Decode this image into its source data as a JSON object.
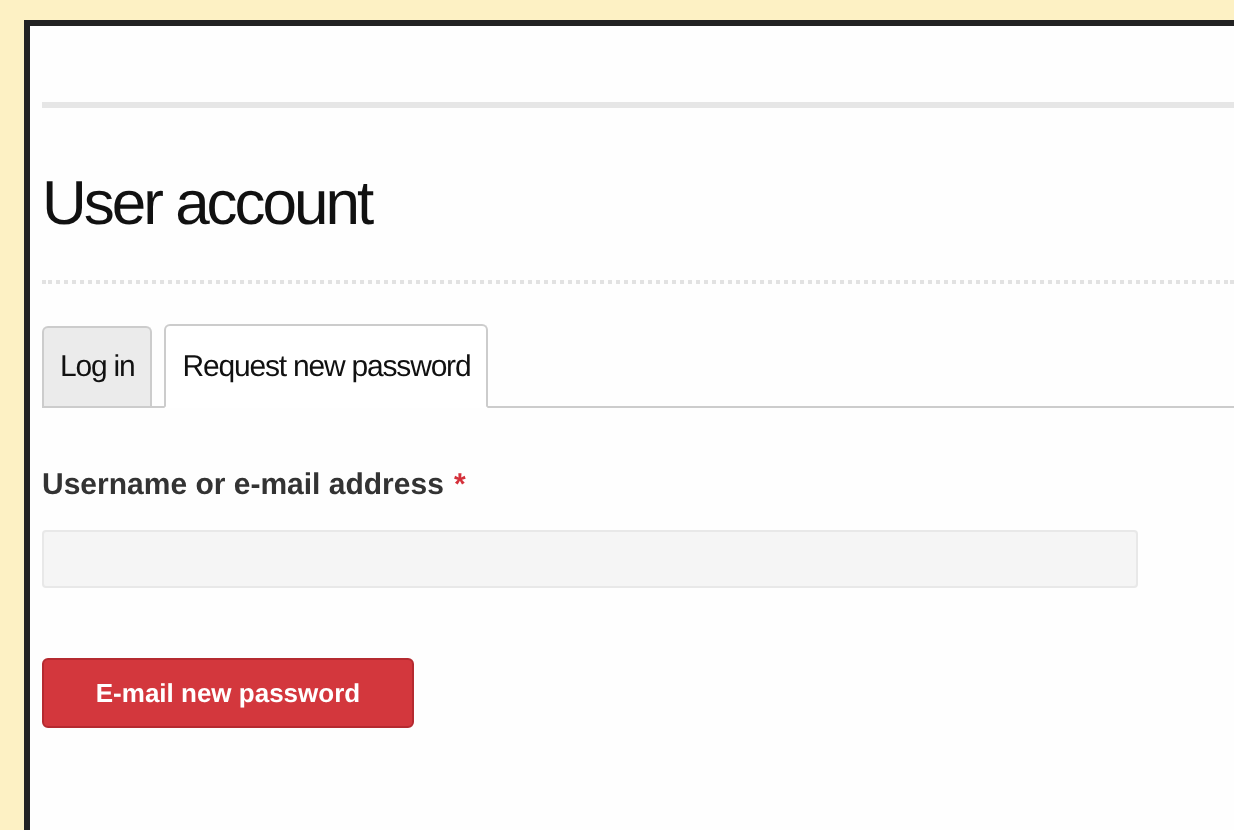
{
  "page": {
    "title": "User account"
  },
  "tabs": [
    {
      "label": "Log in",
      "selected": false
    },
    {
      "label": "Request new password",
      "selected": true
    }
  ],
  "form": {
    "field": {
      "label": "Username or e-mail address",
      "required": true,
      "required_marker": "*"
    },
    "submit": {
      "label": "E-mail new password"
    }
  }
}
